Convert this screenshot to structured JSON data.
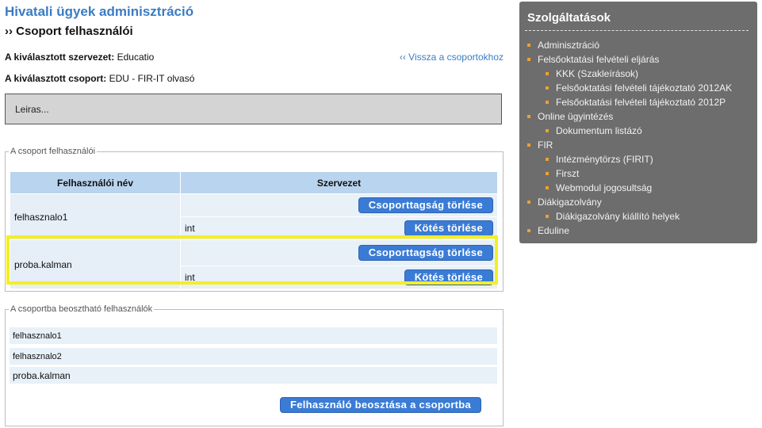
{
  "page": {
    "title": "Hivatali ügyek adminisztráció",
    "subtitle": "›› Csoport felhasználói"
  },
  "info": {
    "org_label": "A kiválasztott szervezet:",
    "org_value": "Educatio",
    "group_label": "A kiválasztott csoport:",
    "group_value": "EDU - FIR-IT olvasó",
    "back_link": "‹‹ Vissza a csoportokhoz"
  },
  "description": "Leiras...",
  "members": {
    "legend": "A csoport felhasználói",
    "headers": [
      "Felhasználói név",
      "Szervezet"
    ],
    "rows": [
      {
        "name": "felhasznalo1",
        "delete_membership": "Csoporttagság törlése",
        "org": "int",
        "delete_binding": "Kötés törlése"
      },
      {
        "name": "proba.kalman",
        "delete_membership": "Csoporttagság törlése",
        "org": "int",
        "delete_binding": "Kötés törlése"
      }
    ]
  },
  "assignable": {
    "legend": "A csoportba beosztható felhasználók",
    "users": [
      "felhasznalo1",
      "felhasznalo2",
      "proba.kalman"
    ],
    "assign_button": "Felhasználó beosztása a csoportba"
  },
  "sidebar": {
    "title": "Szolgáltatások",
    "items": [
      {
        "label": "Adminisztráció",
        "level": 0
      },
      {
        "label": "Felsőoktatási felvételi eljárás",
        "level": 0
      },
      {
        "label": "KKK (Szakleírások)",
        "level": 1
      },
      {
        "label": "Felsőoktatási felvételi tájékoztató 2012AK",
        "level": 1
      },
      {
        "label": "Felsőoktatási felvételi tájékoztató 2012P",
        "level": 1
      },
      {
        "label": "Online ügyintézés",
        "level": 0
      },
      {
        "label": "Dokumentum listázó",
        "level": 1
      },
      {
        "label": "FIR",
        "level": 0
      },
      {
        "label": "Intézménytörzs (FIRIT)",
        "level": 1
      },
      {
        "label": "Firszt",
        "level": 1
      },
      {
        "label": "Webmodul jogosultság",
        "level": 1
      },
      {
        "label": "Diákigazolvány",
        "level": 0
      },
      {
        "label": "Diákigazolvány kiállító helyek",
        "level": 1
      },
      {
        "label": "Eduline",
        "level": 0
      }
    ]
  },
  "colors": {
    "accent": "#3a7cc4",
    "button": "#3a7bd5",
    "highlight": "#f5ee22",
    "sidebar_bg": "#6d6d6d",
    "bullet": "#f0a030"
  }
}
